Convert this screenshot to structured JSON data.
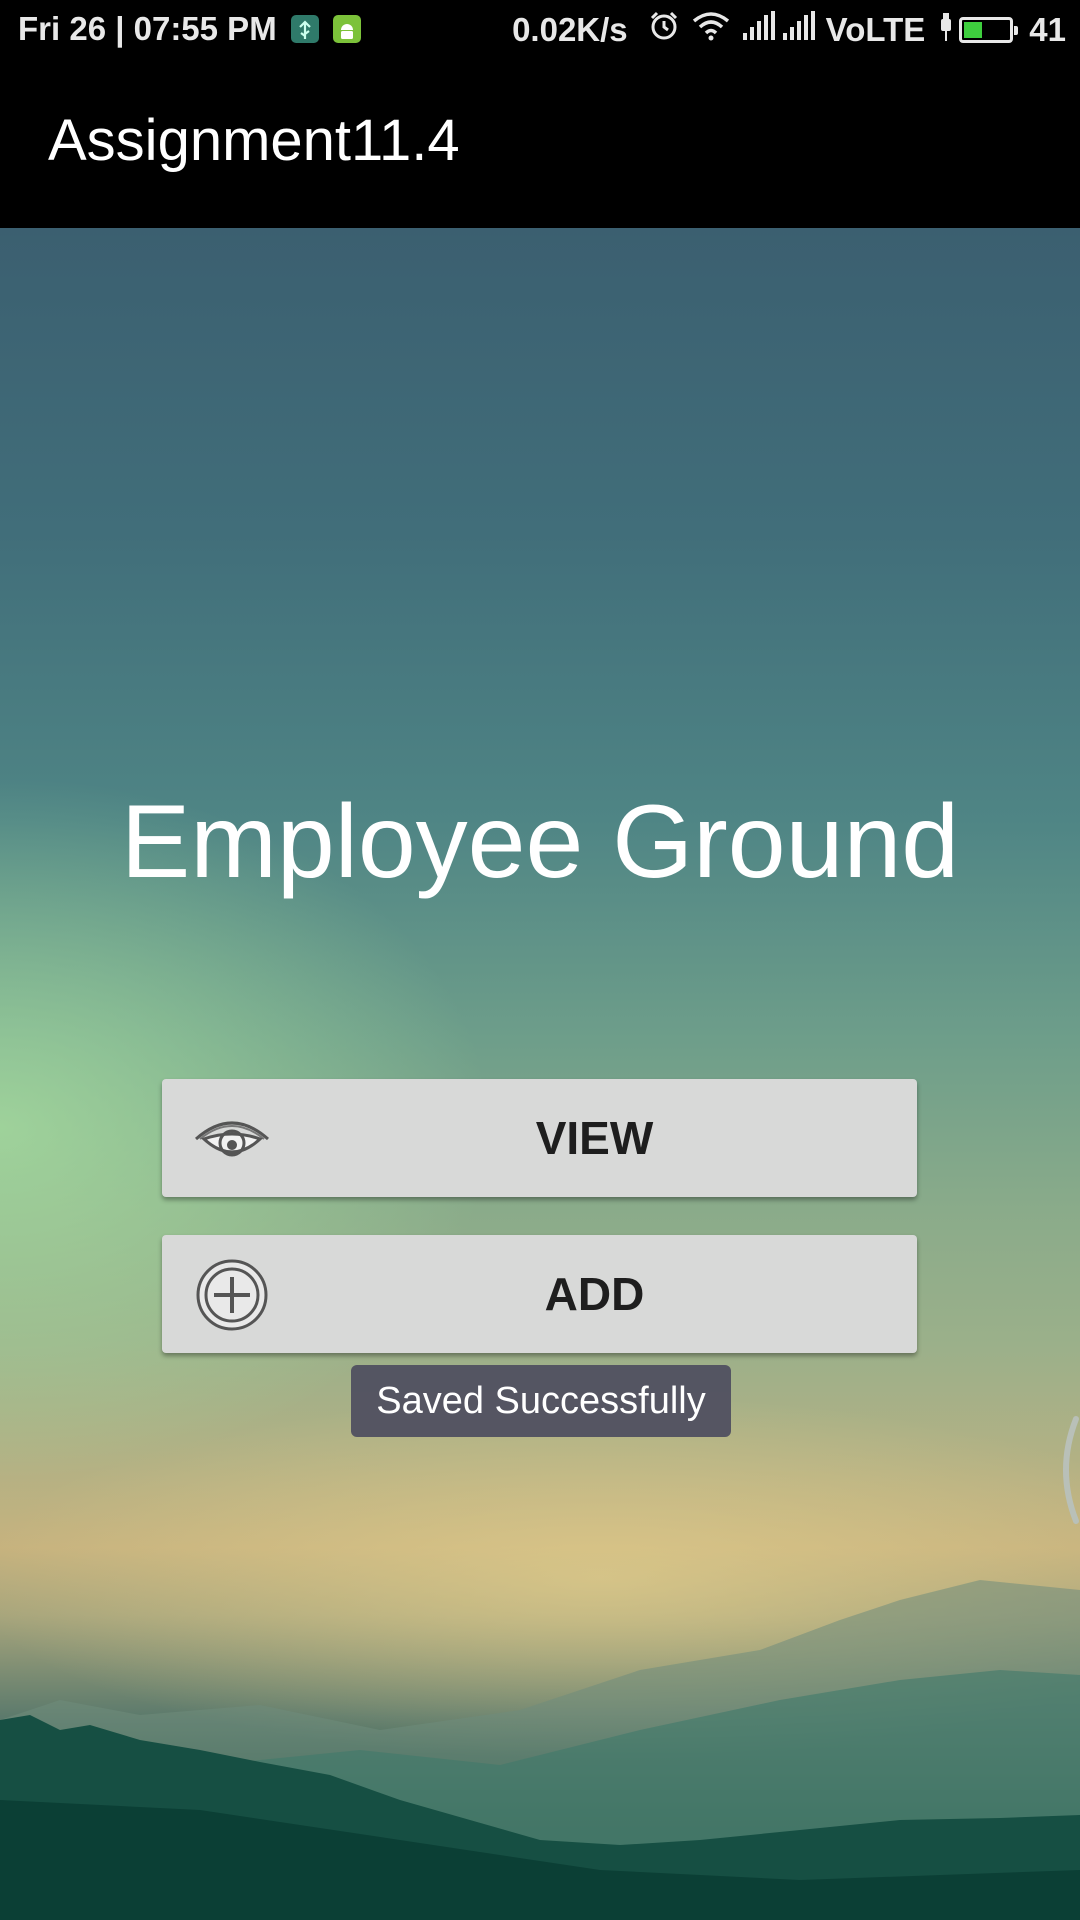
{
  "status_bar": {
    "datetime": "Fri 26 | 07:55 PM",
    "net_speed": "0.02K/s",
    "network_type": "VoLTE",
    "battery_percent": "41",
    "battery_level": 0.41,
    "icons": [
      "usb-debug-icon",
      "android-icon",
      "alarm-icon",
      "wifi-icon",
      "signal-icon",
      "signal-icon",
      "charging-icon",
      "battery-icon"
    ]
  },
  "action_bar": {
    "title": "Assignment11.4"
  },
  "main": {
    "title": "Employee Ground",
    "buttons": {
      "view": {
        "label": "VIEW",
        "icon": "eye-icon"
      },
      "add": {
        "label": "ADD",
        "icon": "add-circle-icon"
      }
    }
  },
  "toast": {
    "message": "Saved Successfully"
  },
  "colors": {
    "status_bar_bg": "#000000",
    "action_bar_bg": "#000000",
    "button_bg": "#d8d9d8",
    "button_text": "#1e1e1e",
    "toast_bg": "#505060",
    "battery_fill": "#3ecf3e"
  }
}
